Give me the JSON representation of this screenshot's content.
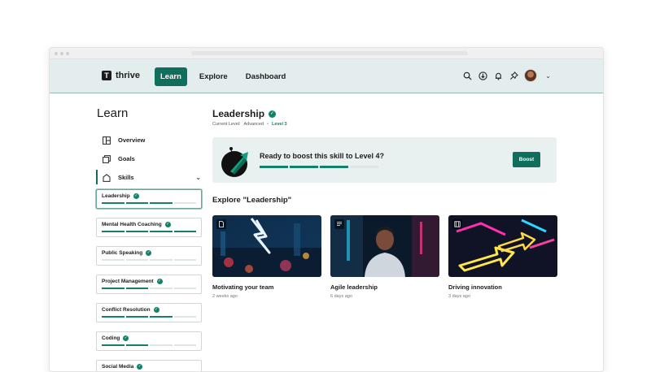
{
  "app": {
    "logo_letter": "T",
    "name": "thrive"
  },
  "nav": {
    "tabs": [
      {
        "label": "Learn",
        "active": true
      },
      {
        "label": "Explore",
        "active": false
      },
      {
        "label": "Dashboard",
        "active": false
      }
    ],
    "icons": [
      "search-icon",
      "download-icon",
      "bell-icon",
      "pin-icon"
    ],
    "accent": "#0f6e5c"
  },
  "sidebar": {
    "title": "Learn",
    "items": [
      {
        "label": "Overview",
        "icon": "overview-icon"
      },
      {
        "label": "Goals",
        "icon": "goals-icon"
      },
      {
        "label": "Skills",
        "icon": "skills-icon"
      }
    ],
    "skills": [
      {
        "name": "Leadership",
        "progress_segments": 3,
        "total_segments": 4
      },
      {
        "name": "Mental Health Coaching",
        "progress_segments": 4,
        "total_segments": 4
      },
      {
        "name": "Public Speaking",
        "progress_segments": 0,
        "total_segments": 4
      },
      {
        "name": "Project Management",
        "progress_segments": 2,
        "total_segments": 4
      },
      {
        "name": "Conflict Resolution",
        "progress_segments": 3,
        "total_segments": 4
      },
      {
        "name": "Coding",
        "progress_segments": 2,
        "total_segments": 4
      },
      {
        "name": "Social Media",
        "progress_segments": 1,
        "total_segments": 4
      }
    ]
  },
  "main": {
    "title": "Leadership",
    "current_level_label": "Current Level:",
    "current_level_value": "Advanced",
    "bullet": "•",
    "level": "Level 3",
    "banner": {
      "text": "Ready to boost this skill to Level 4?",
      "progress_segments": 3,
      "total_segments": 4,
      "button_label": "Boost"
    },
    "explore_title": "Explore \"Leadership\"",
    "cards": [
      {
        "title": "Motivating your team",
        "date": "2 weeks ago",
        "type_icon": "document-icon"
      },
      {
        "title": "Agile leadership",
        "date": "6 days ago",
        "type_icon": "article-icon"
      },
      {
        "title": "Driving innovation",
        "date": "3 days ago",
        "type_icon": "video-icon"
      }
    ]
  }
}
